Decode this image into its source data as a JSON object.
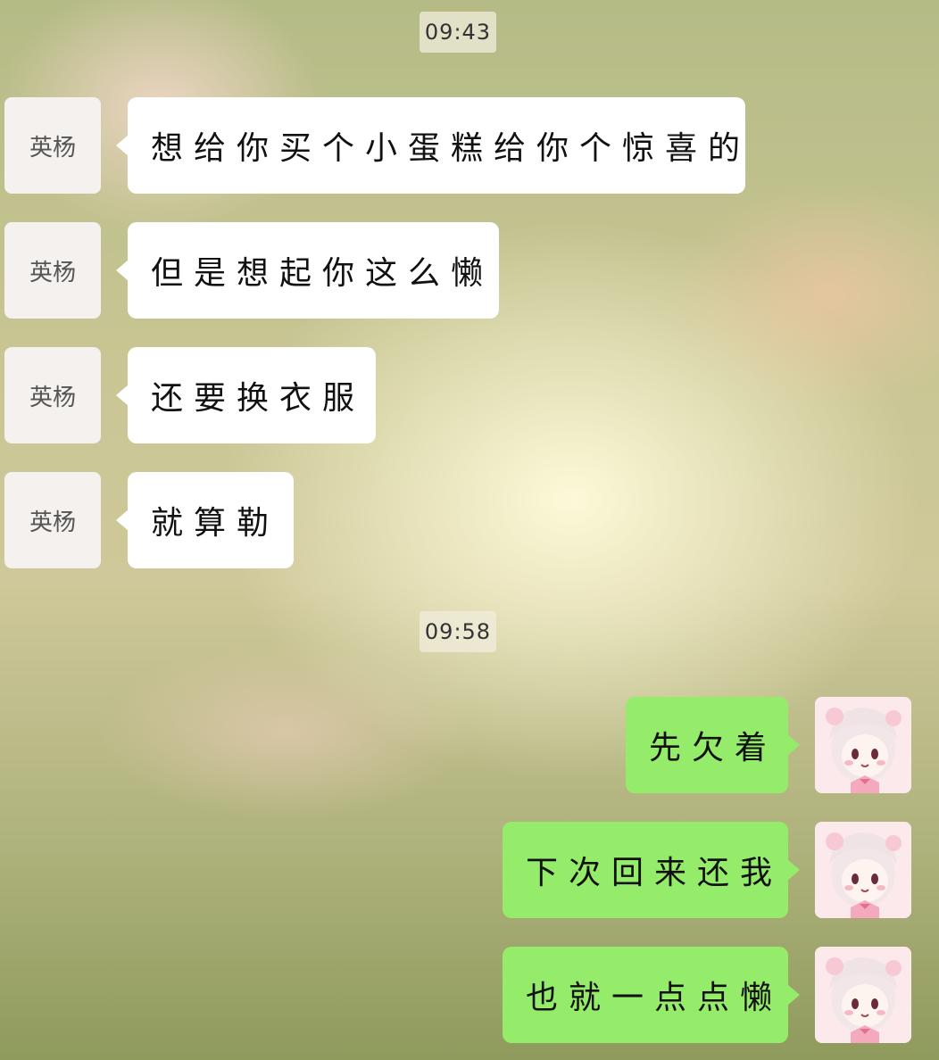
{
  "chat": {
    "timestamps": [
      "09:43",
      "09:58"
    ],
    "contact_avatar_text": "英杨",
    "received": [
      {
        "text": "想给你买个小蛋糕给你个惊喜的"
      },
      {
        "text": "但是想起你这么懒"
      },
      {
        "text": "还要换衣服"
      },
      {
        "text": "就算勒"
      }
    ],
    "sent": [
      {
        "text": "先欠着"
      },
      {
        "text": "下次回来还我"
      },
      {
        "text": "也就一点点懒"
      }
    ],
    "colors": {
      "sent_bubble": "#95ec6a",
      "received_bubble": "#ffffff"
    },
    "self_avatar_icon": "anime-girl-avatar-icon"
  }
}
